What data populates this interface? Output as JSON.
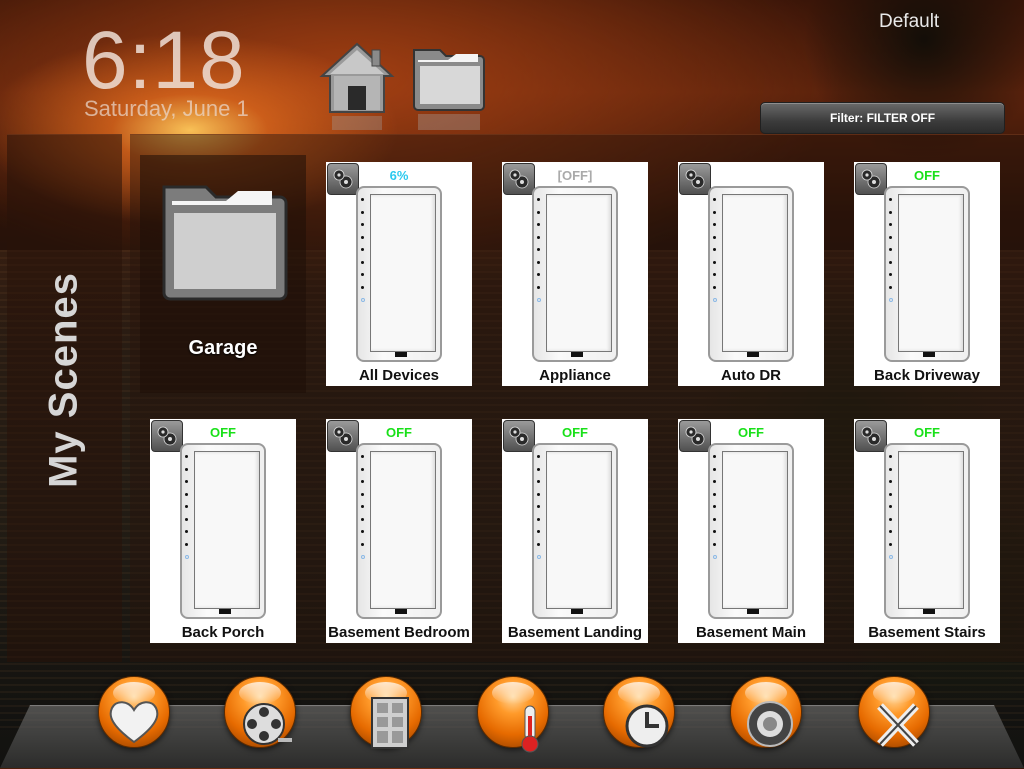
{
  "header": {
    "time": "6:18",
    "date": "Saturday, June 1",
    "profile": "Default"
  },
  "top_icons": [
    "home-icon",
    "folder-icon"
  ],
  "filter": {
    "label": "Filter: FILTER OFF"
  },
  "side": {
    "title": "My Scenes"
  },
  "folder": {
    "label": "Garage",
    "icon": "folder-icon"
  },
  "devices": [
    {
      "name": "All Devices",
      "status": "6%"
    },
    {
      "name": "Appliance",
      "status": "[OFF]"
    },
    {
      "name": "Auto DR",
      "status": ""
    },
    {
      "name": "Back Driveway",
      "status": "OFF"
    },
    {
      "name": "Back Porch",
      "status": "OFF"
    },
    {
      "name": "Basement Bedroom",
      "status": "OFF"
    },
    {
      "name": "Basement Landing",
      "status": "OFF"
    },
    {
      "name": "Basement Main",
      "status": "OFF"
    },
    {
      "name": "Basement Stairs",
      "status": "OFF"
    }
  ],
  "dock": [
    {
      "icon": "heart-icon"
    },
    {
      "icon": "film-reel-icon"
    },
    {
      "icon": "door-icon"
    },
    {
      "icon": "thermometer-icon"
    },
    {
      "icon": "clock-timer-icon"
    },
    {
      "icon": "speaker-icon"
    },
    {
      "icon": "tools-icon"
    }
  ],
  "colors": {
    "status_on": "#2cc9ee",
    "status_off": "#19e019",
    "status_disabled": "#aaaaaa",
    "dock_orb": "#ff9a2a"
  }
}
